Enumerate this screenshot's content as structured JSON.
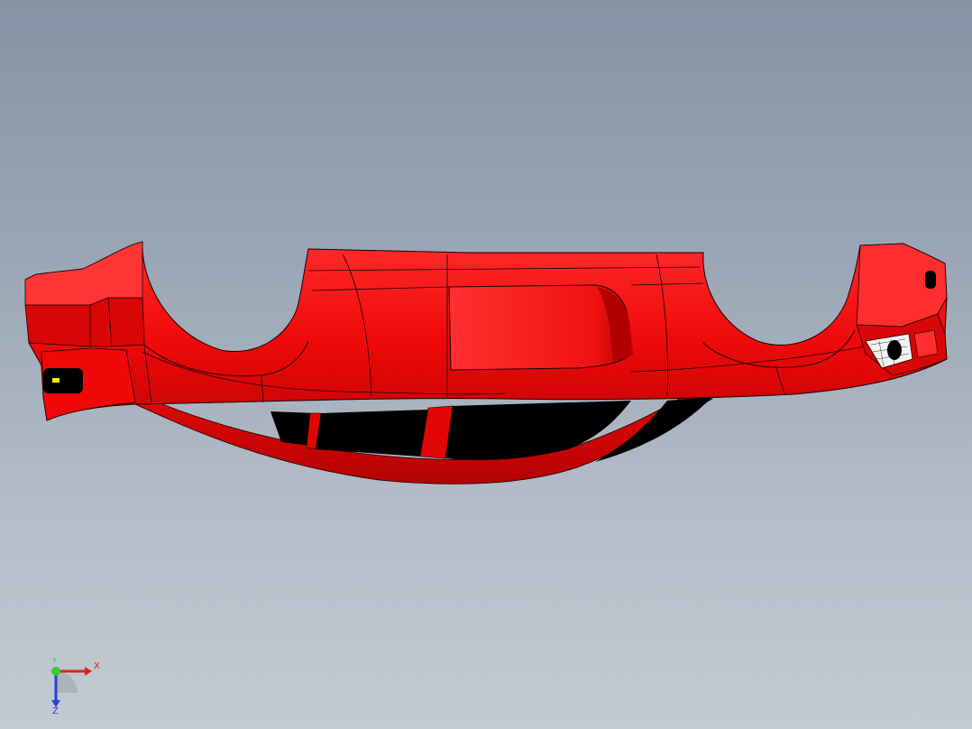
{
  "viewport": {
    "background_top": "#8593a6",
    "background_bottom": "#c3cad3"
  },
  "model": {
    "body_color": "#f00a0a",
    "shadow_color": "#a80000",
    "edge_color": "#1a0000",
    "opening_color": "#000000",
    "light_color": "#fff200"
  },
  "triad": {
    "x_label": "X",
    "y_label": "Y",
    "z_label": "Z",
    "x_color": "#e41e1e",
    "y_color": "#2fd02f",
    "z_color": "#2a3fd6"
  }
}
